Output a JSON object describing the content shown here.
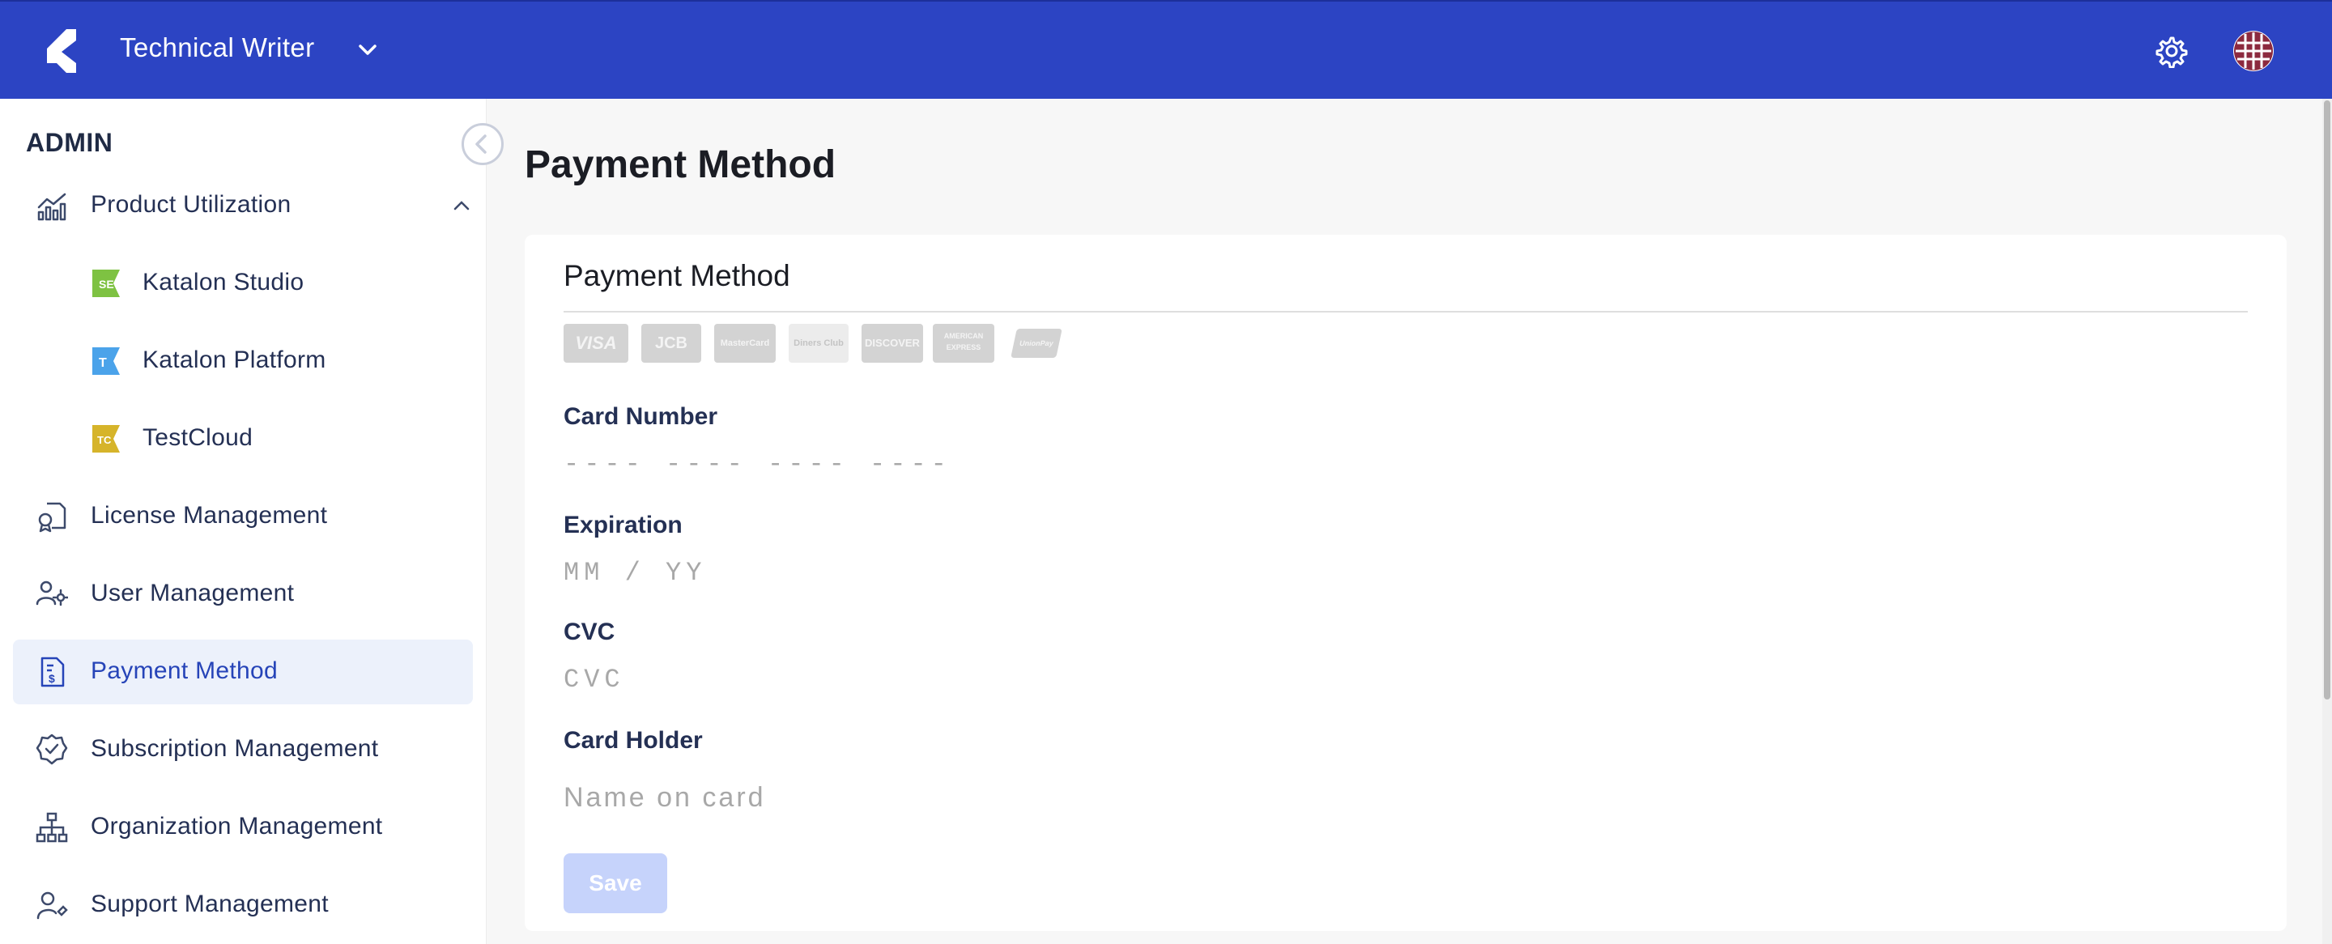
{
  "header": {
    "org_name": "Technical Writer",
    "icons": [
      "katalon-logo-icon",
      "chevron-down-icon",
      "gear-icon",
      "avatar"
    ],
    "background": "#2c44c3"
  },
  "sidebar": {
    "section_title": "ADMIN",
    "items": [
      {
        "label": "Product Utilization",
        "icon": "chart-icon",
        "expanded": true
      },
      {
        "label": "Katalon Studio",
        "icon": "katalon-studio-icon"
      },
      {
        "label": "Katalon Platform",
        "icon": "katalon-platform-icon"
      },
      {
        "label": "TestCloud",
        "icon": "testcloud-icon"
      },
      {
        "label": "License Management",
        "icon": "license-icon"
      },
      {
        "label": "User Management",
        "icon": "user-gear-icon"
      },
      {
        "label": "Payment Method",
        "icon": "invoice-dollar-icon",
        "active": true
      },
      {
        "label": "Subscription Management",
        "icon": "badge-check-icon"
      },
      {
        "label": "Organization Management",
        "icon": "org-chart-icon"
      },
      {
        "label": "Support Management",
        "icon": "user-support-icon"
      }
    ],
    "active_color": "#2644b8"
  },
  "main": {
    "page_title": "Payment Method",
    "card": {
      "title": "Payment Method",
      "brands": [
        "VISA",
        "JCB",
        "MasterCard",
        "Diners Club",
        "DISCOVER",
        "AMERICAN EXPRESS",
        "UnionPay"
      ],
      "fields": [
        {
          "label": "Card Number",
          "placeholder": "---- ---- ---- ----"
        },
        {
          "label": "Expiration",
          "placeholder": "MM / YY"
        },
        {
          "label": "CVC",
          "placeholder": "CVC"
        },
        {
          "label": "Card Holder",
          "placeholder": "Name on card"
        }
      ],
      "save_label": "Save"
    }
  }
}
